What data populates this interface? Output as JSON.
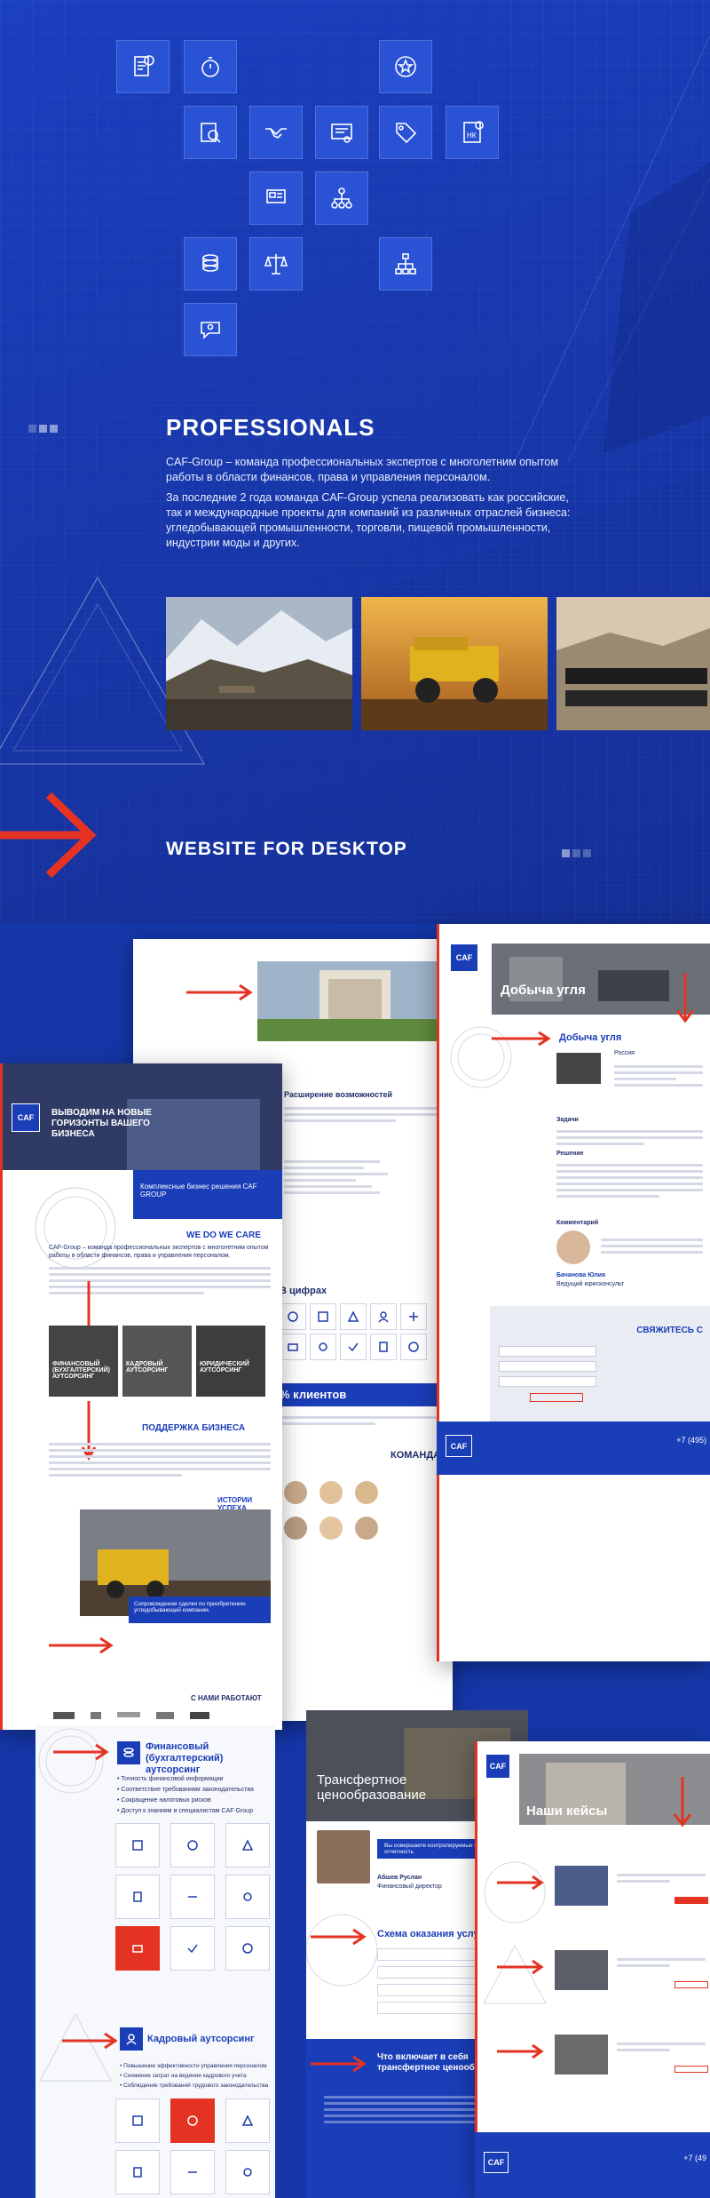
{
  "professionals": {
    "title": "PROFESSIONALS",
    "p1": "CAF-Group – команда профессиональных экспертов с многолетним опытом работы в области финансов, права и управления персоналом.",
    "p2": "За последние 2 года команда CAF-Group успела реализовать как российские, так и международные проекты для компаний из различных отраслей бизнеса: угледобывающей промышленности, торговли, пищевой промышленности, индустрии моды и других."
  },
  "desktop": {
    "title": "WEBSITE FOR DESKTOP"
  },
  "icons": [
    "document-clock-icon",
    "stopwatch-icon",
    "star-badge-icon",
    "magnifier-doc-icon",
    "handshake-icon",
    "certificate-icon",
    "price-tag-icon",
    "tax-document-icon",
    "presentation-icon",
    "org-chart-icon",
    "coins-icon",
    "scales-icon",
    "hierarchy-icon",
    "chat-person-icon"
  ],
  "tax_badge": "НК",
  "colors": {
    "brand_blue": "#1a3db8",
    "accent_red": "#e53323"
  },
  "mock_main": {
    "hero_text": "ВЫВОДИМ НА НОВЫЕ ГОРИЗОНТЫ ВАШЕГО БИЗНЕСА",
    "complex": "Комплексные бизнес решения CAF GROUP",
    "we_do_title": "WE DO WE CARE",
    "we_do_text": "CAF-Group – команда профессиональных экспертов с многолетним опытом работы в области финансов, права и управления персоналом.",
    "services": [
      "ФИНАНСОВЫЙ (БУХГАЛТЕРСКИЙ) АУТСОРСИНГ",
      "КАДРОВЫЙ АУТСОРСИНГ",
      "ЮРИДИЧЕСКИЙ АУТСОРСИНГ"
    ],
    "support_title": "ПОДДЕРЖКА БИЗНЕСА",
    "success_title": "ИСТОРИИ УСПЕХА",
    "success_caption": "Сопровождение сделки по приобретению угледобывающей компании.",
    "partners_title": "С НАМИ РАБОТАЮТ",
    "possibilities": "Расширение возможностей",
    "in_numbers": "В цифрах",
    "clients": "% клиентов",
    "team": "КОМАНДА"
  },
  "mock_coal": {
    "hero": "Добыча угля",
    "heading": "Добыча угля",
    "region": "Россия",
    "tasks": "Задачи",
    "solution": "Решение",
    "commentary": "Комментарий",
    "person": "Бачанова Юлия",
    "person_role": "Ведущий юрисконсульт",
    "contact": "СВЯЖИТЕСЬ С",
    "phone": "+7 (495)"
  },
  "mock_fin": {
    "title": "Финансовый (бухгалтерский) аутсорсинг",
    "bullets": [
      "Точность финансовой информации",
      "Соответствие требованиям законодательства",
      "Сокращение налоговых рисков",
      "Доступ к знаниям и специалистам CAF Group"
    ],
    "hr_title": "Кадровый аутсорсинг",
    "hr_bullets": [
      "Повышение эффективности управления персоналом",
      "Снижение затрат на ведение кадрового учета",
      "Соблюдение требований трудового законодательства"
    ]
  },
  "mock_transfer": {
    "hero": "Трансфертное ценообразование",
    "quote": "Вы совершаете контролируемые сделки и сдаете отчетность",
    "person": "Абшев Руслан",
    "role": "Финансовый директор",
    "scheme": "Схема оказания услуг",
    "includes": "Что включает в себя трансфертное ценообразование"
  },
  "mock_cases": {
    "hero": "Наши кейсы",
    "phone": "+7 (49"
  }
}
